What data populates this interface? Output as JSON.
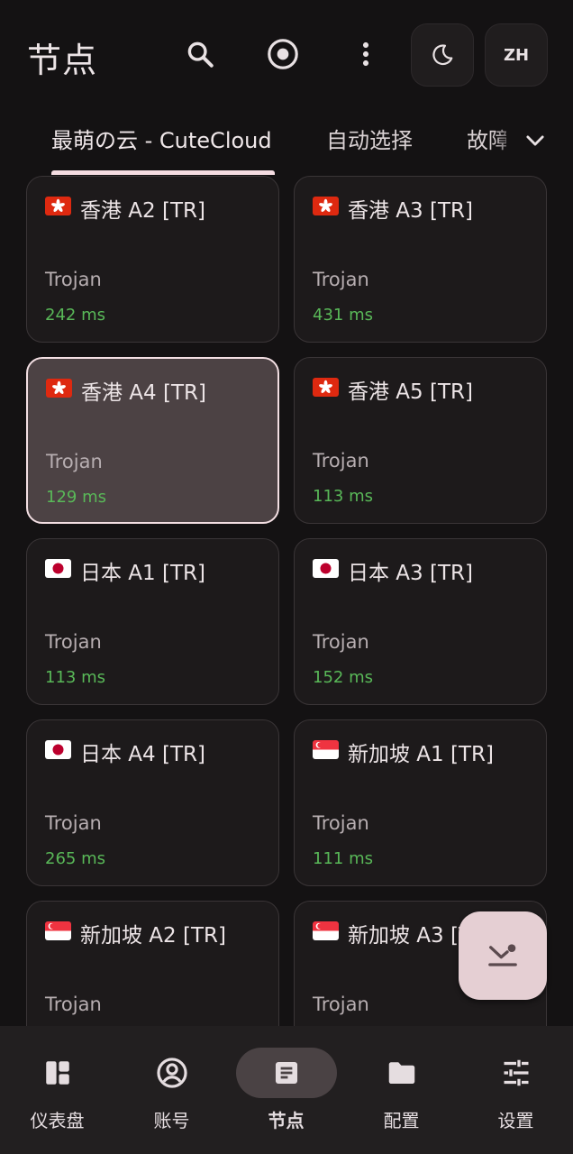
{
  "header": {
    "title": "节点",
    "lang_label": "ZH",
    "icons": [
      "search-icon",
      "target-icon",
      "more-vertical-icon",
      "moon-icon"
    ]
  },
  "tabs": [
    {
      "label": "最萌の云 - CuteCloud",
      "active": true
    },
    {
      "label": "自动选择",
      "active": false
    },
    {
      "label": "故障转移",
      "active": false
    }
  ],
  "nodes": [
    {
      "flag": "HK",
      "name": "香港 A2 [TR]",
      "type": "Trojan",
      "delay": "242 ms",
      "selected": false
    },
    {
      "flag": "HK",
      "name": "香港 A3 [TR]",
      "type": "Trojan",
      "delay": "431 ms",
      "selected": false
    },
    {
      "flag": "HK",
      "name": "香港 A4 [TR]",
      "type": "Trojan",
      "delay": "129 ms",
      "selected": true
    },
    {
      "flag": "HK",
      "name": "香港 A5 [TR]",
      "type": "Trojan",
      "delay": "113 ms",
      "selected": false
    },
    {
      "flag": "JP",
      "name": "日本 A1 [TR]",
      "type": "Trojan",
      "delay": "113 ms",
      "selected": false
    },
    {
      "flag": "JP",
      "name": "日本 A3 [TR]",
      "type": "Trojan",
      "delay": "152 ms",
      "selected": false
    },
    {
      "flag": "JP",
      "name": "日本 A4 [TR]",
      "type": "Trojan",
      "delay": "265 ms",
      "selected": false
    },
    {
      "flag": "SG",
      "name": "新加坡 A1 [TR]",
      "type": "Trojan",
      "delay": "111 ms",
      "selected": false
    },
    {
      "flag": "SG",
      "name": "新加坡 A2 [TR]",
      "type": "Trojan",
      "delay": "",
      "selected": false
    },
    {
      "flag": "SG",
      "name": "新加坡 A3 [TR]",
      "type": "Trojan",
      "delay": "",
      "selected": false
    }
  ],
  "fab": {
    "icon": "locate-collapse-icon"
  },
  "bottom_nav": [
    {
      "label": "仪表盘",
      "icon": "dashboard-icon",
      "active": false
    },
    {
      "label": "账号",
      "icon": "account-icon",
      "active": false
    },
    {
      "label": "节点",
      "icon": "article-icon",
      "active": true
    },
    {
      "label": "配置",
      "icon": "folder-icon",
      "active": false
    },
    {
      "label": "设置",
      "icon": "tune-icon",
      "active": false
    }
  ],
  "colors": {
    "background": "#141213",
    "card": "#1d1a1b",
    "card_selected": "#4c4244",
    "delay_green": "#59b858",
    "accent": "#f5dde2",
    "fab": "#e5cfd3"
  }
}
